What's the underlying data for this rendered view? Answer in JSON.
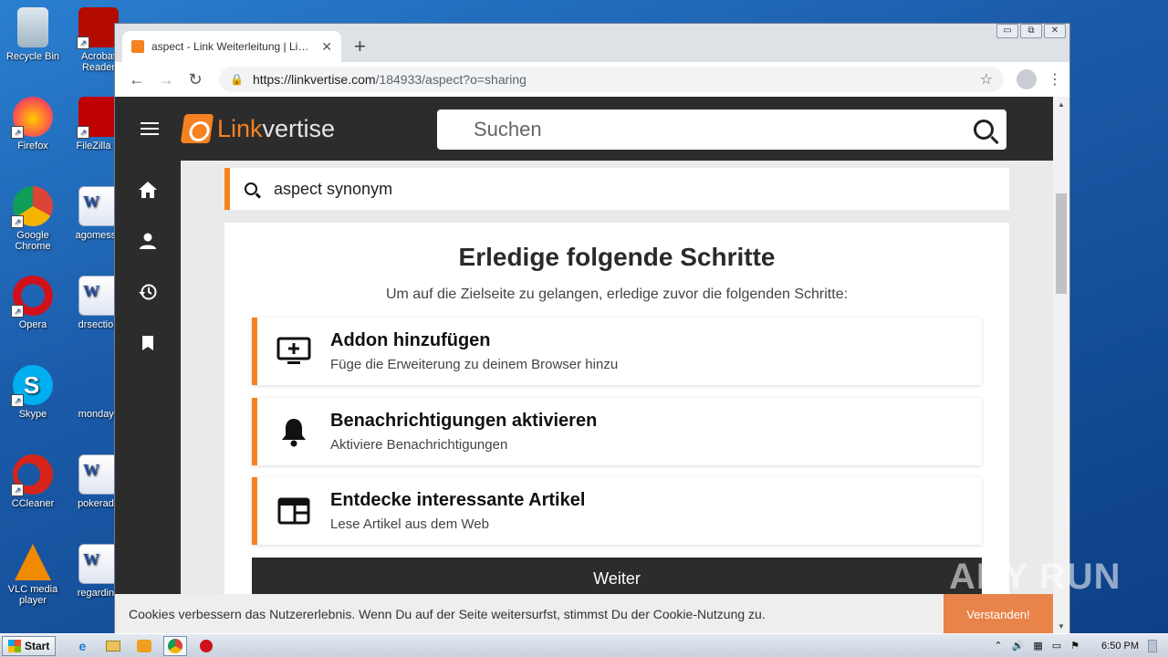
{
  "desktop": {
    "icons": [
      {
        "label": "Recycle Bin",
        "icon": "recycle-bin-icon"
      },
      {
        "label": "Acrobat Reader",
        "icon": "acrobat-icon"
      },
      {
        "label": "Firefox",
        "icon": "firefox-icon"
      },
      {
        "label": "FileZilla C",
        "icon": "filezilla-icon"
      },
      {
        "label": "Google Chrome",
        "icon": "chrome-icon"
      },
      {
        "label": "agomessa",
        "icon": "word-doc-icon"
      },
      {
        "label": "Opera",
        "icon": "opera-icon"
      },
      {
        "label": "drsection",
        "icon": "word-doc-icon"
      },
      {
        "label": "Skype",
        "icon": "skype-icon"
      },
      {
        "label": "mondayk",
        "icon": "word-doc-icon"
      },
      {
        "label": "CCleaner",
        "icon": "ccleaner-icon"
      },
      {
        "label": "pokerado",
        "icon": "word-doc-icon"
      },
      {
        "label": "VLC media player",
        "icon": "vlc-icon"
      },
      {
        "label": "regarding",
        "icon": "word-doc-icon"
      }
    ]
  },
  "browser": {
    "tab_title": "aspect - Link Weiterleitung | Linkvertise",
    "tab_close": "✕",
    "new_tab": "+",
    "url_host": "https://linkvertise.com",
    "url_path": "/184933/aspect?o=sharing",
    "window_controls": {
      "minimize": "▭",
      "restore": "⧉",
      "close": "✕"
    }
  },
  "page": {
    "brand": {
      "part1": "Link",
      "part2": "vertise"
    },
    "search_placeholder": "Suchen",
    "query": "aspect synonym",
    "heading": "Erledige folgende Schritte",
    "subheading": "Um auf die Zielseite zu gelangen, erledige zuvor die folgenden Schritte:",
    "steps": [
      {
        "title": "Addon hinzufügen",
        "desc": "Füge die Erweiterung zu deinem Browser hinzu",
        "icon": "add-to-screen-icon"
      },
      {
        "title": "Benachrichtigungen aktivieren",
        "desc": "Aktiviere Benachrichtigungen",
        "icon": "bell-icon"
      },
      {
        "title": "Entdecke interessante Artikel",
        "desc": "Lese Artikel aus dem Web",
        "icon": "web-article-icon"
      }
    ],
    "continue_button": "Weiter",
    "cookie_text": "Cookies verbessern das Nutzererlebnis. Wenn Du auf der Seite weitersurfst, stimmst Du der Cookie-Nutzung zu.",
    "cookie_button": "Verstanden!",
    "accent_color": "#f58220"
  },
  "watermark": "ANY RUN",
  "taskbar": {
    "start_label": "Start",
    "clock": "6:50 PM"
  }
}
